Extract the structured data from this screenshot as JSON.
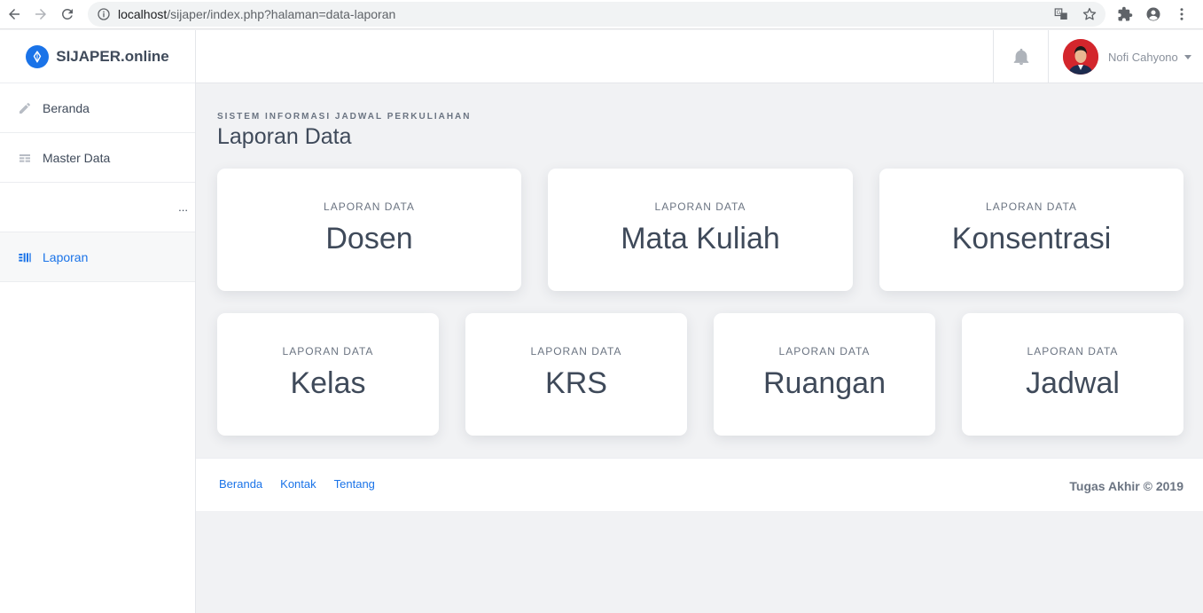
{
  "browser": {
    "url_host": "localhost",
    "url_path": "/sijaper/index.php?halaman=data-laporan"
  },
  "brand": {
    "name": "SIJAPER.online"
  },
  "sidebar": {
    "items": [
      {
        "label": "Beranda",
        "icon": "pencil-icon"
      },
      {
        "label": "Master Data",
        "icon": "table-icon"
      },
      {
        "label": "Laporan",
        "icon": "report-icon"
      }
    ],
    "ellipsis": "..."
  },
  "header": {
    "user_name": "Nofi Cahyono"
  },
  "main": {
    "subtitle": "SISTEM INFORMASI JADWAL PERKULIAHAN",
    "title": "Laporan Data",
    "cards": [
      {
        "kicker": "LAPORAN DATA",
        "title": "Dosen"
      },
      {
        "kicker": "LAPORAN DATA",
        "title": "Mata Kuliah"
      },
      {
        "kicker": "LAPORAN DATA",
        "title": "Konsentrasi"
      },
      {
        "kicker": "LAPORAN DATA",
        "title": "Kelas"
      },
      {
        "kicker": "LAPORAN DATA",
        "title": "KRS"
      },
      {
        "kicker": "LAPORAN DATA",
        "title": "Ruangan"
      },
      {
        "kicker": "LAPORAN DATA",
        "title": "Jadwal"
      }
    ]
  },
  "footer": {
    "links": [
      "Beranda",
      "Kontak",
      "Tentang"
    ],
    "copyright": "Tugas Akhir © 2019"
  },
  "colors": {
    "accent": "#1a73e8",
    "text": "#3f4a5a",
    "muted": "#6b7482",
    "background": "#f1f2f4"
  }
}
